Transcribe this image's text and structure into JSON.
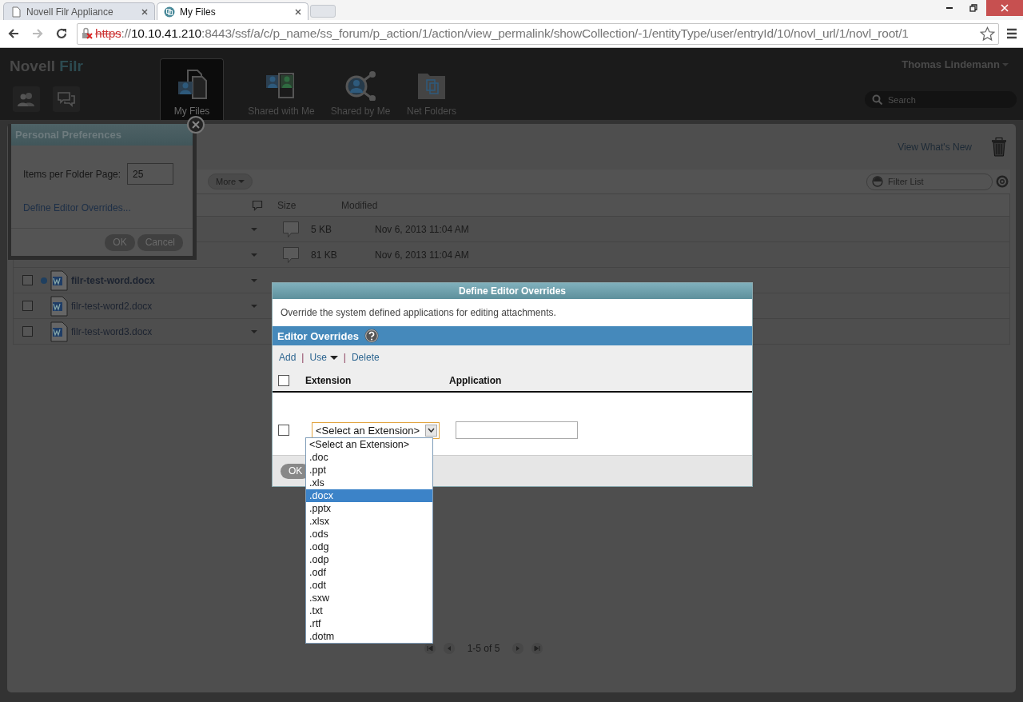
{
  "browser": {
    "tabs": [
      {
        "title": "Novell Filr Appliance",
        "selected": false
      },
      {
        "title": "My Files",
        "selected": true
      }
    ],
    "address": {
      "scheme": "https",
      "scheme_separator": "://",
      "host": "10.10.41.210",
      "rest": ":8443/ssf/a/c/p_name/ss_forum/p_action/1/action/view_permalink/showCollection/-1/entityType/user/entryId/10/novl_url/1/novl_root/1"
    }
  },
  "header": {
    "logo": {
      "brand": "Novell",
      "product": "Filr"
    },
    "nav": [
      {
        "label": "My Files",
        "selected": true
      },
      {
        "label": "Shared with Me",
        "selected": false
      },
      {
        "label": "Shared by Me",
        "selected": false
      },
      {
        "label": "Net Folders",
        "selected": false
      }
    ],
    "user": "Thomas Lindemann",
    "search": {
      "placeholder": "Search"
    }
  },
  "content": {
    "whats_new": "View What's New",
    "more_button": "More",
    "filter": {
      "placeholder": "Filter List"
    },
    "columns": {
      "size": "Size",
      "modified": "Modified"
    },
    "rows": [
      {
        "size": "5 KB",
        "modified": "Nov 6, 2013 11:04 AM"
      },
      {
        "size": "81 KB",
        "modified": "Nov 6, 2013 11:04 AM"
      },
      {
        "name": "filr-test-word.docx",
        "checked": false,
        "unread": true
      },
      {
        "name": "filr-test-word2.docx",
        "checked": false,
        "unread": false
      },
      {
        "name": "filr-test-word3.docx",
        "checked": false,
        "unread": false
      }
    ],
    "pager": "1-5 of 5"
  },
  "preferences_dialog": {
    "title": "Personal Preferences",
    "items_label": "Items per Folder Page:",
    "items_value": "25",
    "overrides_link": "Define Editor Overrides...",
    "buttons": [
      "OK",
      "Cancel"
    ]
  },
  "overrides_dialog": {
    "title": "Define Editor Overrides",
    "description": "Override the system defined applications for editing attachments.",
    "section": "Editor Overrides",
    "actions": [
      "Add",
      "Use",
      "Delete"
    ],
    "action_separator": "|",
    "columns": [
      "Extension",
      "Application"
    ],
    "header_checked": false,
    "row": {
      "checked": false,
      "extension": "<Select an Extension>"
    },
    "options": [
      {
        "label": "<Select an Extension>",
        "selected": false
      },
      {
        "label": ".doc",
        "selected": false
      },
      {
        "label": ".ppt",
        "selected": false
      },
      {
        "label": ".xls",
        "selected": false
      },
      {
        "label": ".docx",
        "selected": true
      },
      {
        "label": ".pptx",
        "selected": false
      },
      {
        "label": ".xlsx",
        "selected": false
      },
      {
        "label": ".ods",
        "selected": false
      },
      {
        "label": ".odg",
        "selected": false
      },
      {
        "label": ".odp",
        "selected": false
      },
      {
        "label": ".odf",
        "selected": false
      },
      {
        "label": ".odt",
        "selected": false
      },
      {
        "label": ".sxw",
        "selected": false
      },
      {
        "label": ".txt",
        "selected": false
      },
      {
        "label": ".rtf",
        "selected": false
      },
      {
        "label": ".dotm",
        "selected": false
      }
    ],
    "ok_button": "OK"
  }
}
